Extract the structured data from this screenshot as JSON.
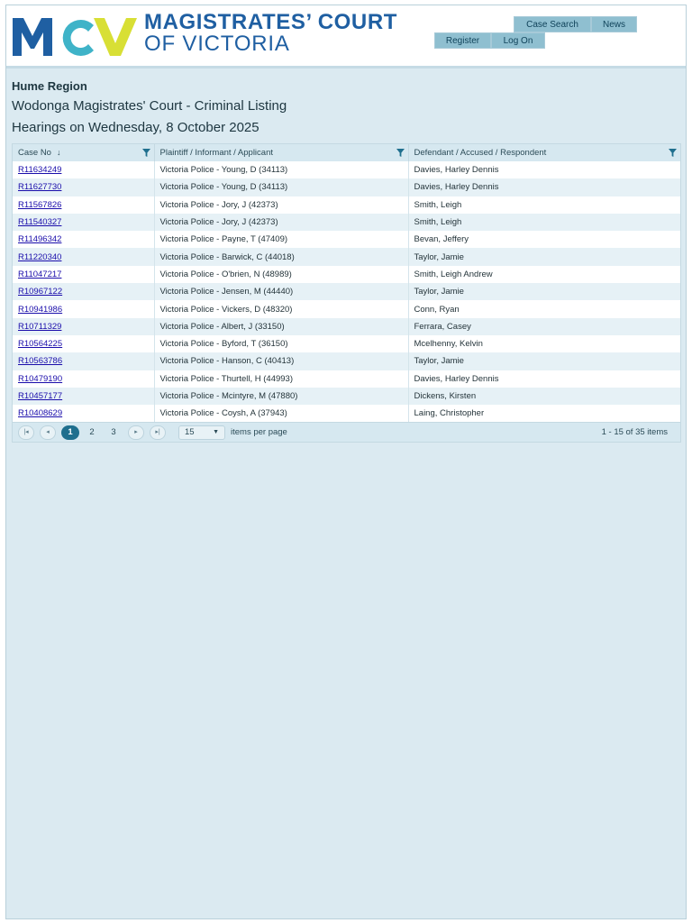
{
  "header": {
    "logo_text": "MCV",
    "court_line1": "MAGISTRATES’ COURT",
    "court_line2": "OF VICTORIA",
    "nav": {
      "case_search": "Case Search",
      "news": "News",
      "register": "Register",
      "log_on": "Log On"
    },
    "colors": {
      "brand_blue": "#1f5fa2",
      "brand_teal": "#3fb3c8",
      "brand_yellow": "#d6dd2a",
      "nav_button": "#8fbfd0"
    }
  },
  "page": {
    "region": "Hume Region",
    "listing_title": "Wodonga Magistrates' Court - Criminal Listing",
    "hearing_date": "Hearings on Wednesday, 8 October 2025"
  },
  "table": {
    "columns": [
      "Case No",
      "Plaintiff / Informant / Applicant",
      "Defendant / Accused / Respondent"
    ],
    "sort_icon": "sort-down-arrow-icon",
    "filter_icon": "filter-funnel-icon",
    "rows": [
      [
        "R11634249",
        "Victoria Police - Young, D (34113)",
        "Davies, Harley Dennis"
      ],
      [
        "R11627730",
        "Victoria Police - Young, D (34113)",
        "Davies, Harley Dennis"
      ],
      [
        "R11567826",
        "Victoria Police - Jory, J (42373)",
        "Smith, Leigh"
      ],
      [
        "R11540327",
        "Victoria Police - Jory, J (42373)",
        "Smith, Leigh"
      ],
      [
        "R11496342",
        "Victoria Police - Payne, T (47409)",
        "Bevan, Jeffery"
      ],
      [
        "R11220340",
        "Victoria Police - Barwick, C (44018)",
        "Taylor, Jamie"
      ],
      [
        "R11047217",
        "Victoria Police - O'brien, N (48989)",
        "Smith, Leigh Andrew"
      ],
      [
        "R10967122",
        "Victoria Police - Jensen, M (44440)",
        "Taylor, Jamie"
      ],
      [
        "R10941986",
        "Victoria Police - Vickers, D (48320)",
        "Conn, Ryan"
      ],
      [
        "R10711329",
        "Victoria Police - Albert, J (33150)",
        "Ferrara, Casey"
      ],
      [
        "R10564225",
        "Victoria Police - Byford, T (36150)",
        "Mcelhenny, Kelvin"
      ],
      [
        "R10563786",
        "Victoria Police - Hanson, C (40413)",
        "Taylor, Jamie"
      ],
      [
        "R10479190",
        "Victoria Police - Thurtell, H (44993)",
        "Davies, Harley Dennis"
      ],
      [
        "R10457177",
        "Victoria Police - Mcintyre, M (47880)",
        "Dickens, Kirsten"
      ],
      [
        "R10408629",
        "Victoria Police - Coysh, A (37943)",
        "Laing, Christopher"
      ]
    ]
  },
  "pager": {
    "first": "|◂",
    "prev": "◂",
    "next": "▸",
    "last": "▸|",
    "pages": [
      "1",
      "2",
      "3"
    ],
    "current_page": "1",
    "page_size": "15",
    "page_size_caret": "▼",
    "items_per_page": "items per page",
    "info": "1 - 15 of 35 items"
  }
}
